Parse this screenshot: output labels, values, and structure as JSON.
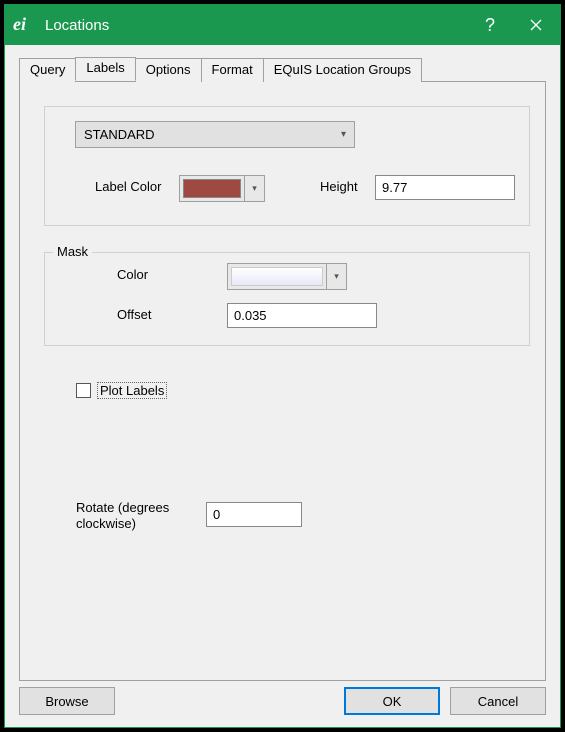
{
  "window": {
    "title": "Locations",
    "app_icon_text": "ei"
  },
  "tabs": {
    "query": "Query",
    "labels": "Labels",
    "options": "Options",
    "format": "Format",
    "equis": "EQuIS Location Groups"
  },
  "style": {
    "selected": "STANDARD",
    "label_color_label": "Label Color",
    "label_color_value": "#9e4a42",
    "height_label": "Height",
    "height_value": "9.77"
  },
  "mask": {
    "legend": "Mask",
    "color_label": "Color",
    "offset_label": "Offset",
    "offset_value": "0.035"
  },
  "checkbox": {
    "plot_labels": "Plot Labels"
  },
  "rotate": {
    "label": "Rotate (degrees clockwise)",
    "value": "0"
  },
  "buttons": {
    "browse": "Browse",
    "ok": "OK",
    "cancel": "Cancel"
  },
  "symbols": {
    "help": "?",
    "close": "✕",
    "chevron_down": "▾"
  }
}
